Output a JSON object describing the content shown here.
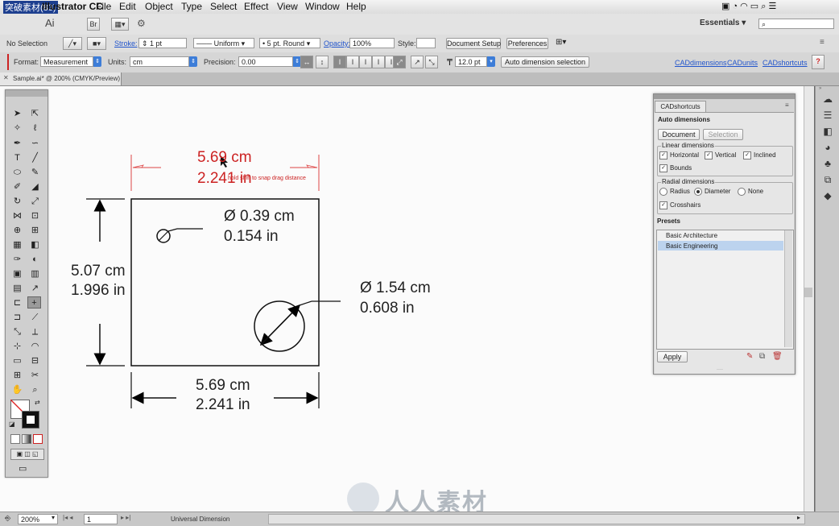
{
  "menubar": {
    "app": "Illustrator CC",
    "items": [
      "File",
      "Edit",
      "Object",
      "Type",
      "Select",
      "Effect",
      "View",
      "Window",
      "Help"
    ],
    "workspace": "Essentials"
  },
  "control": {
    "selection": "No Selection",
    "stroke_label": "Stroke:",
    "stroke_value": "1 pt",
    "profile": "Uniform",
    "brush": "5 pt. Round",
    "opacity_label": "Opacity:",
    "opacity_value": "100%",
    "style_label": "Style:",
    "document_setup": "Document Setup",
    "preferences": "Preferences"
  },
  "cad": {
    "format_label": "Format:",
    "format_value": "Measurement",
    "units_label": "Units:",
    "units_value": "cm",
    "precision_label": "Precision:",
    "precision_value": "0.00",
    "font_size": "12.0 pt",
    "auto_button": "Auto dimension selection",
    "links": [
      "CADdimensions",
      "CADunits",
      "CADshortcuts"
    ],
    "help": "?"
  },
  "doc_tab": "Sample.ai* @ 200% (CMYK/Preview)",
  "drawing": {
    "top_dim_cm": "5.69 cm",
    "top_dim_in": "2.241 in",
    "hint": "hold shift to snap drag distance",
    "small_circle_cm": "Ø 0.39 cm",
    "small_circle_in": "0.154 in",
    "left_dim_cm": "5.07 cm",
    "left_dim_in": "1.996 in",
    "big_circle_cm": "Ø 1.54 cm",
    "big_circle_in": "0.608 in",
    "bottom_dim_cm": "5.69 cm",
    "bottom_dim_in": "2.241 in"
  },
  "panel": {
    "title": "CADshortcuts",
    "auto_dimensions": "Auto dimensions",
    "tab_document": "Document",
    "tab_selection": "Selection",
    "linear_title": "Linear dimensions",
    "horizontal": "Horizontal",
    "vertical": "Vertical",
    "inclined": "Inclined",
    "bounds": "Bounds",
    "radial_title": "Radial dimensions",
    "radius": "Radius",
    "diameter": "Diameter",
    "none": "None",
    "crosshairs": "Crosshairs",
    "presets_title": "Presets",
    "presets": [
      "Basic Architecture",
      "Basic Engineering"
    ],
    "selected_preset": "Basic Engineering",
    "apply": "Apply"
  },
  "status": {
    "zoom": "200%",
    "page": "1",
    "tool": "Universal Dimension"
  },
  "watermark": "人人素材",
  "overlay_text": "突破素材(83)",
  "colors": {
    "dim_red": "#cc2222",
    "accent_blue": "#3d7dd8",
    "preset_highlight": "#bcd3ee"
  }
}
